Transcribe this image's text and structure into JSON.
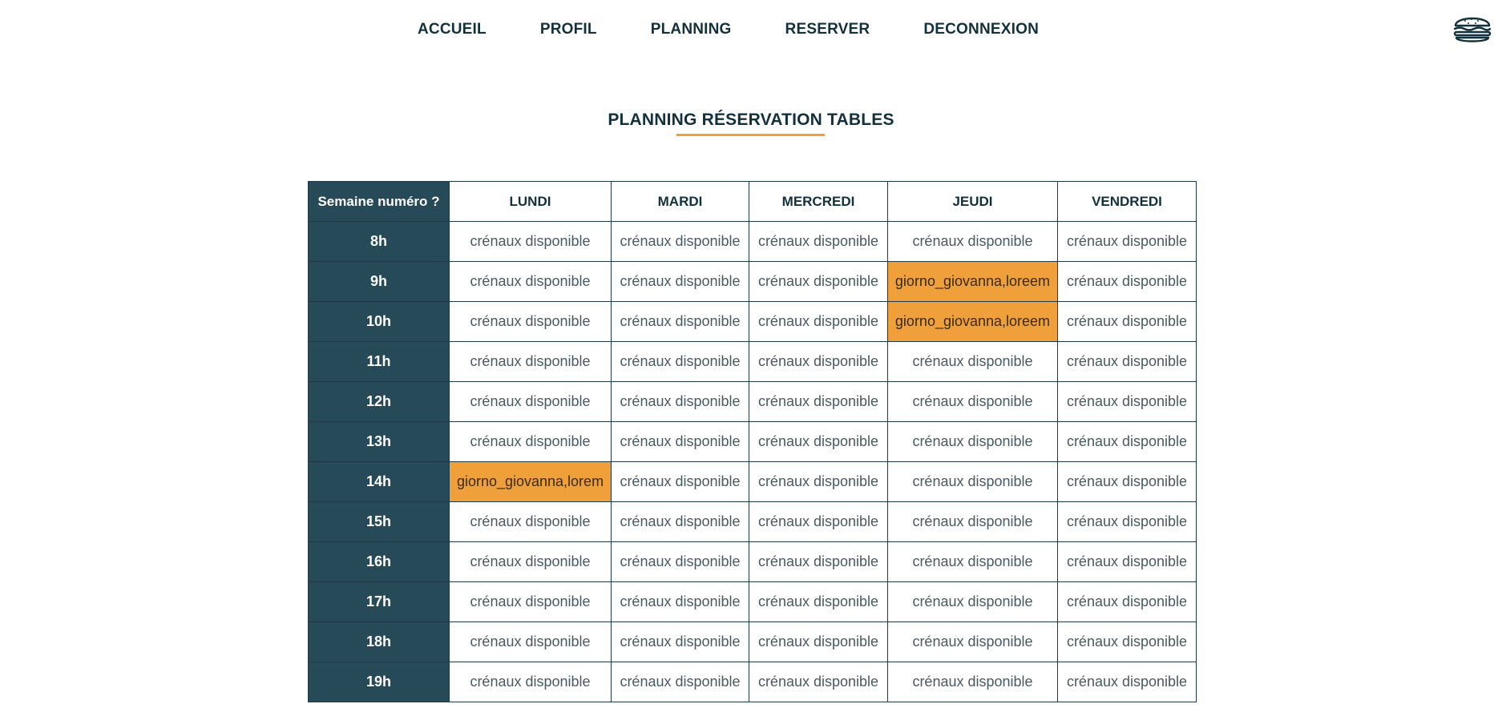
{
  "nav": {
    "links": [
      "ACCUEIL",
      "PROFIL",
      "PLANNING",
      "RESERVER",
      "DECONNEXION"
    ],
    "menu_icon": "burger-icon"
  },
  "page": {
    "title": "PLANNING RÉSERVATION TABLES"
  },
  "schedule": {
    "corner_label": "Semaine numéro ?",
    "days": [
      "LUNDI",
      "MARDI",
      "MERCREDI",
      "JEUDI",
      "VENDREDI"
    ],
    "rows": [
      {
        "hour": "8h",
        "cells": [
          "crénaux disponible",
          "crénaux disponible",
          "crénaux disponible",
          "crénaux disponible",
          "crénaux disponible"
        ],
        "booked": [
          false,
          false,
          false,
          false,
          false
        ]
      },
      {
        "hour": "9h",
        "cells": [
          "crénaux disponible",
          "crénaux disponible",
          "crénaux disponible",
          "giorno_giovanna,loreem",
          "crénaux disponible"
        ],
        "booked": [
          false,
          false,
          false,
          true,
          false
        ]
      },
      {
        "hour": "10h",
        "cells": [
          "crénaux disponible",
          "crénaux disponible",
          "crénaux disponible",
          "giorno_giovanna,loreem",
          "crénaux disponible"
        ],
        "booked": [
          false,
          false,
          false,
          true,
          false
        ]
      },
      {
        "hour": "11h",
        "cells": [
          "crénaux disponible",
          "crénaux disponible",
          "crénaux disponible",
          "crénaux disponible",
          "crénaux disponible"
        ],
        "booked": [
          false,
          false,
          false,
          false,
          false
        ]
      },
      {
        "hour": "12h",
        "cells": [
          "crénaux disponible",
          "crénaux disponible",
          "crénaux disponible",
          "crénaux disponible",
          "crénaux disponible"
        ],
        "booked": [
          false,
          false,
          false,
          false,
          false
        ]
      },
      {
        "hour": "13h",
        "cells": [
          "crénaux disponible",
          "crénaux disponible",
          "crénaux disponible",
          "crénaux disponible",
          "crénaux disponible"
        ],
        "booked": [
          false,
          false,
          false,
          false,
          false
        ]
      },
      {
        "hour": "14h",
        "cells": [
          "giorno_giovanna,lorem",
          "crénaux disponible",
          "crénaux disponible",
          "crénaux disponible",
          "crénaux disponible"
        ],
        "booked": [
          true,
          false,
          false,
          false,
          false
        ]
      },
      {
        "hour": "15h",
        "cells": [
          "crénaux disponible",
          "crénaux disponible",
          "crénaux disponible",
          "crénaux disponible",
          "crénaux disponible"
        ],
        "booked": [
          false,
          false,
          false,
          false,
          false
        ]
      },
      {
        "hour": "16h",
        "cells": [
          "crénaux disponible",
          "crénaux disponible",
          "crénaux disponible",
          "crénaux disponible",
          "crénaux disponible"
        ],
        "booked": [
          false,
          false,
          false,
          false,
          false
        ]
      },
      {
        "hour": "17h",
        "cells": [
          "crénaux disponible",
          "crénaux disponible",
          "crénaux disponible",
          "crénaux disponible",
          "crénaux disponible"
        ],
        "booked": [
          false,
          false,
          false,
          false,
          false
        ]
      },
      {
        "hour": "18h",
        "cells": [
          "crénaux disponible",
          "crénaux disponible",
          "crénaux disponible",
          "crénaux disponible",
          "crénaux disponible"
        ],
        "booked": [
          false,
          false,
          false,
          false,
          false
        ]
      },
      {
        "hour": "19h",
        "cells": [
          "crénaux disponible",
          "crénaux disponible",
          "crénaux disponible",
          "crénaux disponible",
          "crénaux disponible"
        ],
        "booked": [
          false,
          false,
          false,
          false,
          false
        ]
      }
    ]
  },
  "colors": {
    "navy": "#264a57",
    "accent": "#f0a03a",
    "text": "#12303d"
  }
}
